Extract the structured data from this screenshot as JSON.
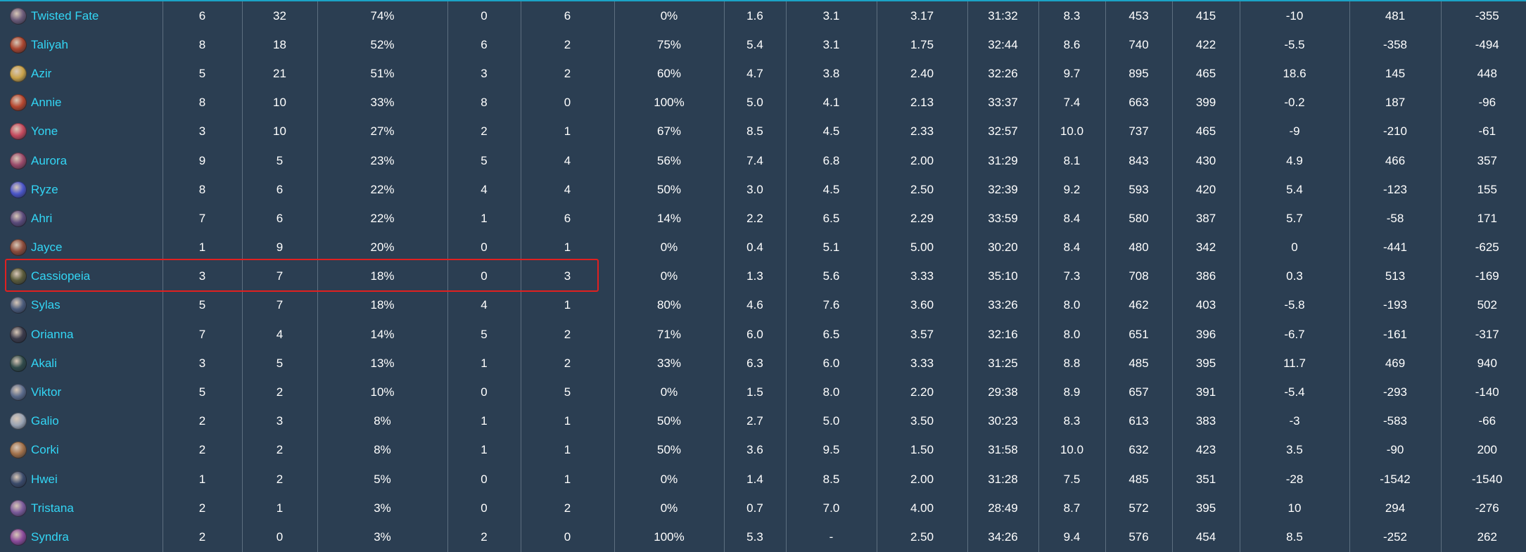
{
  "rows": [
    {
      "champion": "Twisted Fate",
      "icon": "twisted-fate-portrait",
      "icon_color": "#6a5a78",
      "cells": [
        "6",
        "32",
        "74%",
        "0",
        "6",
        "0%",
        "1.6",
        "3.1",
        "3.17",
        "31:32",
        "8.3",
        "453",
        "415",
        "-10",
        "481",
        "-355"
      ]
    },
    {
      "champion": "Taliyah",
      "icon": "taliyah-portrait",
      "icon_color": "#a8442e",
      "cells": [
        "8",
        "18",
        "52%",
        "6",
        "2",
        "75%",
        "5.4",
        "3.1",
        "1.75",
        "32:44",
        "8.6",
        "740",
        "422",
        "-5.5",
        "-358",
        "-494"
      ]
    },
    {
      "champion": "Azir",
      "icon": "azir-portrait",
      "icon_color": "#c9a24a",
      "cells": [
        "5",
        "21",
        "51%",
        "3",
        "2",
        "60%",
        "4.7",
        "3.8",
        "2.40",
        "32:26",
        "9.7",
        "895",
        "465",
        "18.6",
        "145",
        "448"
      ]
    },
    {
      "champion": "Annie",
      "icon": "annie-portrait",
      "icon_color": "#b5462f",
      "cells": [
        "8",
        "10",
        "33%",
        "8",
        "0",
        "100%",
        "5.0",
        "4.1",
        "2.13",
        "33:37",
        "7.4",
        "663",
        "399",
        "-0.2",
        "187",
        "-96"
      ]
    },
    {
      "champion": "Yone",
      "icon": "yone-portrait",
      "icon_color": "#c44a5e",
      "cells": [
        "3",
        "10",
        "27%",
        "2",
        "1",
        "67%",
        "8.5",
        "4.5",
        "2.33",
        "32:57",
        "10.0",
        "737",
        "465",
        "-9",
        "-210",
        "-61"
      ]
    },
    {
      "champion": "Aurora",
      "icon": "aurora-portrait",
      "icon_color": "#9a4a6a",
      "cells": [
        "9",
        "5",
        "23%",
        "5",
        "4",
        "56%",
        "7.4",
        "6.8",
        "2.00",
        "31:29",
        "8.1",
        "843",
        "430",
        "4.9",
        "466",
        "357"
      ]
    },
    {
      "champion": "Ryze",
      "icon": "ryze-portrait",
      "icon_color": "#4a55c8",
      "cells": [
        "8",
        "6",
        "22%",
        "4",
        "4",
        "50%",
        "3.0",
        "4.5",
        "2.50",
        "32:39",
        "9.2",
        "593",
        "420",
        "5.4",
        "-123",
        "155"
      ]
    },
    {
      "champion": "Ahri",
      "icon": "ahri-portrait",
      "icon_color": "#5a4a7a",
      "cells": [
        "7",
        "6",
        "22%",
        "1",
        "6",
        "14%",
        "2.2",
        "6.5",
        "2.29",
        "33:59",
        "8.4",
        "580",
        "387",
        "5.7",
        "-58",
        "171"
      ]
    },
    {
      "champion": "Jayce",
      "icon": "jayce-portrait",
      "icon_color": "#8a4a3a",
      "cells": [
        "1",
        "9",
        "20%",
        "0",
        "1",
        "0%",
        "0.4",
        "5.1",
        "5.00",
        "30:20",
        "8.4",
        "480",
        "342",
        "0",
        "-441",
        "-625"
      ]
    },
    {
      "champion": "Cassiopeia",
      "icon": "cassiopeia-portrait",
      "icon_color": "#5a5a3a",
      "cells": [
        "3",
        "7",
        "18%",
        "0",
        "3",
        "0%",
        "1.3",
        "5.6",
        "3.33",
        "35:10",
        "7.3",
        "708",
        "386",
        "0.3",
        "513",
        "-169"
      ]
    },
    {
      "champion": "Sylas",
      "icon": "sylas-portrait",
      "icon_color": "#4a5a7a",
      "cells": [
        "5",
        "7",
        "18%",
        "4",
        "1",
        "80%",
        "4.6",
        "7.6",
        "3.60",
        "33:26",
        "8.0",
        "462",
        "403",
        "-5.8",
        "-193",
        "502"
      ]
    },
    {
      "champion": "Orianna",
      "icon": "orianna-portrait",
      "icon_color": "#3a3a4a",
      "cells": [
        "7",
        "4",
        "14%",
        "5",
        "2",
        "71%",
        "6.0",
        "6.5",
        "3.57",
        "32:16",
        "8.0",
        "651",
        "396",
        "-6.7",
        "-161",
        "-317"
      ]
    },
    {
      "champion": "Akali",
      "icon": "akali-portrait",
      "icon_color": "#2f4a4a",
      "cells": [
        "3",
        "5",
        "13%",
        "1",
        "2",
        "33%",
        "6.3",
        "6.0",
        "3.33",
        "31:25",
        "8.8",
        "485",
        "395",
        "11.7",
        "469",
        "940"
      ]
    },
    {
      "champion": "Viktor",
      "icon": "viktor-portrait",
      "icon_color": "#5a6a8a",
      "cells": [
        "5",
        "2",
        "10%",
        "0",
        "5",
        "0%",
        "1.5",
        "8.0",
        "2.20",
        "29:38",
        "8.9",
        "657",
        "391",
        "-5.4",
        "-293",
        "-140"
      ]
    },
    {
      "champion": "Galio",
      "icon": "galio-portrait",
      "icon_color": "#9aa4b4",
      "cells": [
        "2",
        "3",
        "8%",
        "1",
        "1",
        "50%",
        "2.7",
        "5.0",
        "3.50",
        "30:23",
        "8.3",
        "613",
        "383",
        "-3",
        "-583",
        "-66"
      ]
    },
    {
      "champion": "Corki",
      "icon": "corki-portrait",
      "icon_color": "#a0704a",
      "cells": [
        "2",
        "2",
        "8%",
        "1",
        "1",
        "50%",
        "3.6",
        "9.5",
        "1.50",
        "31:58",
        "10.0",
        "632",
        "423",
        "3.5",
        "-90",
        "200"
      ]
    },
    {
      "champion": "Hwei",
      "icon": "hwei-portrait",
      "icon_color": "#3a4a6a",
      "cells": [
        "1",
        "2",
        "5%",
        "0",
        "1",
        "0%",
        "1.4",
        "8.5",
        "2.00",
        "31:28",
        "7.5",
        "485",
        "351",
        "-28",
        "-1542",
        "-1540"
      ]
    },
    {
      "champion": "Tristana",
      "icon": "tristana-portrait",
      "icon_color": "#7a5a9a",
      "cells": [
        "2",
        "1",
        "3%",
        "0",
        "2",
        "0%",
        "0.7",
        "7.0",
        "4.00",
        "28:49",
        "8.7",
        "572",
        "395",
        "10",
        "294",
        "-276"
      ]
    },
    {
      "champion": "Syndra",
      "icon": "syndra-portrait",
      "icon_color": "#8a4a9a",
      "cells": [
        "2",
        "0",
        "3%",
        "2",
        "0",
        "100%",
        "5.3",
        "-",
        "2.50",
        "34:26",
        "9.4",
        "576",
        "454",
        "8.5",
        "-252",
        "262"
      ]
    }
  ],
  "highlight_row": "Cassiopeia",
  "colors": {
    "background": "#2b3e52",
    "champion_link": "#33d6f5",
    "highlight": "#e02020",
    "grid": "#5d6f80"
  }
}
